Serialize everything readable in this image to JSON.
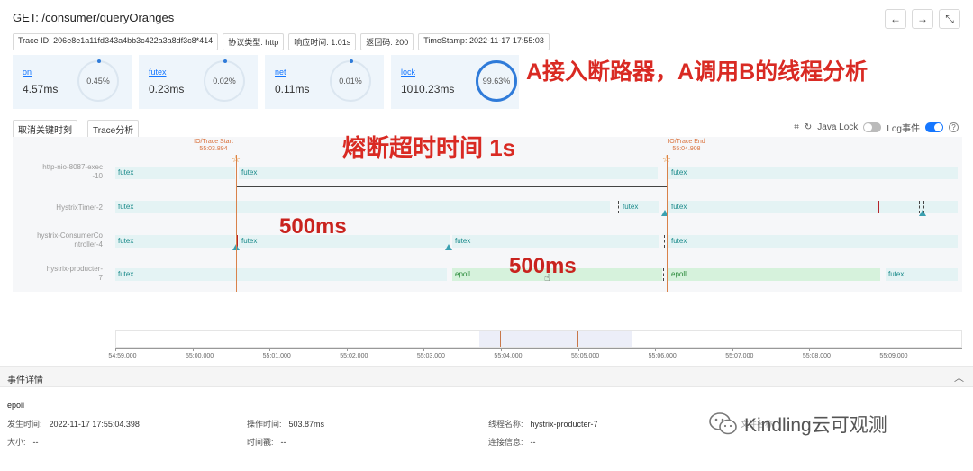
{
  "header": {
    "title": "GET: /consumer/queryOranges"
  },
  "nav": {
    "back": "←",
    "forward": "→",
    "expand": "⤡"
  },
  "tags": [
    "Trace ID: 206e8e1a11fd343a4bb3c422a3a8df3c8*414",
    "协议类型: http",
    "响应时间: 1.01s",
    "返回码: 200",
    "TimeStamp: 2022-11-17 17:55:03"
  ],
  "stats": [
    {
      "name": "on",
      "value": "4.57ms",
      "percent": "0.45%",
      "fraction": 0.0045
    },
    {
      "name": "futex",
      "value": "0.23ms",
      "percent": "0.02%",
      "fraction": 0.0002
    },
    {
      "name": "net",
      "value": "0.11ms",
      "percent": "0.01%",
      "fraction": 0.0001
    },
    {
      "name": "lock",
      "value": "1010.23ms",
      "percent": "99.63%",
      "fraction": 0.9963
    }
  ],
  "overlays": {
    "headline": "A接入断路器，A调用B的线程分析",
    "timeout": "熔断超时时间 1s",
    "first_500": "500ms",
    "second_500": "500ms"
  },
  "buttons": {
    "cancel_key": "取消关键时刻",
    "trace_analysis": "Trace分析"
  },
  "controls": {
    "java_lock": "Java Lock",
    "log_events": "Log事件",
    "help": "?",
    "java_lock_on": false,
    "log_events_on": true
  },
  "io_markers": {
    "start_label": "IO/Trace Start",
    "start_time": "55:03.894",
    "end_label": "IO/Trace End",
    "end_time": "55:04.908"
  },
  "threads": [
    {
      "label_line1": "http-nio-8087-exec",
      "label_line2": "-10",
      "segments": [
        "futex",
        "futex",
        "futex"
      ]
    },
    {
      "label_line1": "HystrixTimer-2",
      "label_line2": "",
      "segments": [
        "futex",
        "futex",
        "futex"
      ]
    },
    {
      "label_line1": "hystrix-ConsumerCo",
      "label_line2": "ntroller-4",
      "segments": [
        "futex",
        "futex",
        "futex",
        "futex"
      ]
    },
    {
      "label_line1": "hystrix-producter-",
      "label_line2": "7",
      "segments": [
        "futex",
        "epoll",
        "epoll",
        "futex"
      ]
    }
  ],
  "axis_ticks": [
    "54:59.000",
    "55:00.000",
    "55:01.000",
    "55:02.000",
    "55:03.000",
    "55:04.000",
    "55:05.000",
    "55:06.000",
    "55:07.000",
    "55:08.000",
    "55:09.000"
  ],
  "details": {
    "heading": "事件详情",
    "event_name": "epoll",
    "fields": [
      {
        "key": "发生时间:",
        "value": "2022-11-17 17:55:04.398"
      },
      {
        "key": "操作时间:",
        "value": "503.87ms"
      },
      {
        "key": "线程名称:",
        "value": "hystrix-producter-7"
      },
      {
        "key": "大小:",
        "value": "--"
      },
      {
        "key": "时间戳:",
        "value": "--"
      },
      {
        "key": "连接信息:",
        "value": "--"
      }
    ]
  },
  "watermark": {
    "text": "Kindling云可观测",
    "partial": "文件名称"
  },
  "colors": {
    "accent": "#1677ff",
    "overlay_red": "#d92a23",
    "io_orange": "#d9824a",
    "futex_bg": "#e4f3f4",
    "epoll_bg": "#d6f2dc"
  }
}
